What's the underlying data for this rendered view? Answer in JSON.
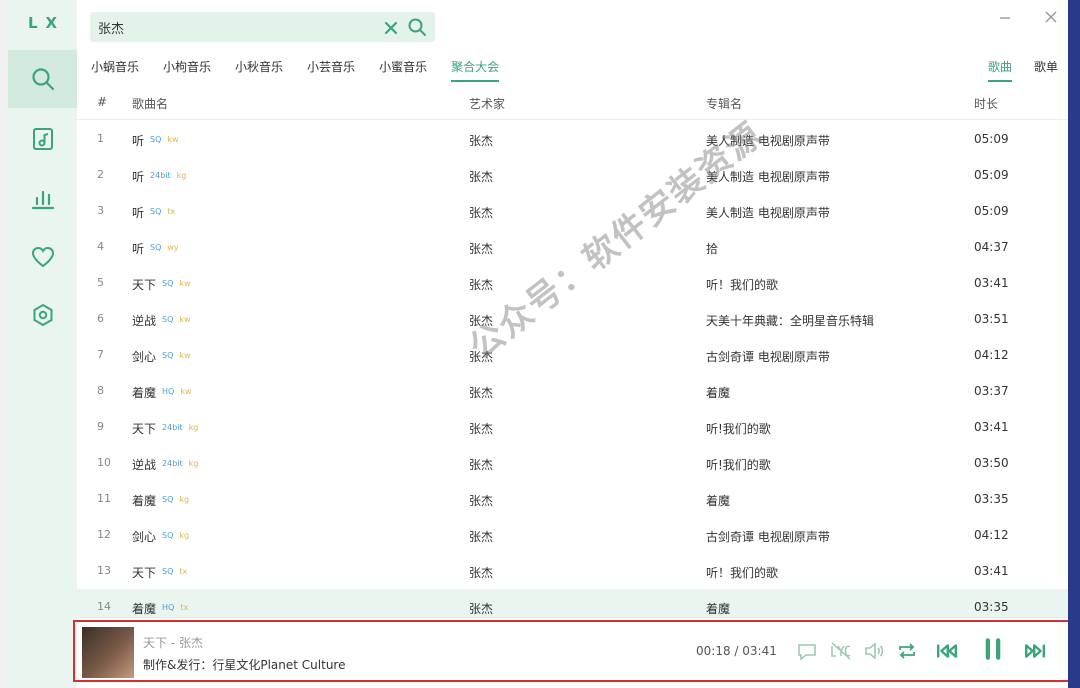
{
  "app": {
    "logo": "LX"
  },
  "search": {
    "value": "张杰"
  },
  "source_tabs": [
    "小蜗音乐",
    "小枸音乐",
    "小秋音乐",
    "小芸音乐",
    "小蜜音乐",
    "聚合大会"
  ],
  "type_tabs": [
    "歌曲",
    "歌单"
  ],
  "table": {
    "headers": [
      "#",
      "歌曲名",
      "艺术家",
      "专辑名",
      "时长"
    ],
    "rows": [
      {
        "num": "1",
        "name": "听",
        "quality": "SQ",
        "source": "kw",
        "artist": "张杰",
        "album": "美人制造 电视剧原声带",
        "duration": "05:09"
      },
      {
        "num": "2",
        "name": "听",
        "quality": "24bit",
        "source": "kg",
        "artist": "张杰",
        "album": "美人制造 电视剧原声带",
        "duration": "05:09"
      },
      {
        "num": "3",
        "name": "听",
        "quality": "SQ",
        "source": "tx",
        "artist": "张杰",
        "album": "美人制造 电视剧原声带",
        "duration": "05:09"
      },
      {
        "num": "4",
        "name": "听",
        "quality": "SQ",
        "source": "wy",
        "artist": "张杰",
        "album": "拾",
        "duration": "04:37"
      },
      {
        "num": "5",
        "name": "天下",
        "quality": "SQ",
        "source": "kw",
        "artist": "张杰",
        "album": "听！我们的歌",
        "duration": "03:41"
      },
      {
        "num": "6",
        "name": "逆战",
        "quality": "SQ",
        "source": "kw",
        "artist": "张杰",
        "album": "天美十年典藏：全明星音乐特辑",
        "duration": "03:51"
      },
      {
        "num": "7",
        "name": "剑心",
        "quality": "SQ",
        "source": "kw",
        "artist": "张杰",
        "album": "古剑奇谭 电视剧原声带",
        "duration": "04:12"
      },
      {
        "num": "8",
        "name": "着魔",
        "quality": "HQ",
        "source": "kw",
        "artist": "张杰",
        "album": "着魔",
        "duration": "03:37"
      },
      {
        "num": "9",
        "name": "天下",
        "quality": "24bit",
        "source": "kg",
        "artist": "张杰",
        "album": "听!我们的歌",
        "duration": "03:41"
      },
      {
        "num": "10",
        "name": "逆战",
        "quality": "24bit",
        "source": "kg",
        "artist": "张杰",
        "album": "听!我们的歌",
        "duration": "03:50"
      },
      {
        "num": "11",
        "name": "着魔",
        "quality": "SQ",
        "source": "kg",
        "artist": "张杰",
        "album": "着魔",
        "duration": "03:35"
      },
      {
        "num": "12",
        "name": "剑心",
        "quality": "SQ",
        "source": "kg",
        "artist": "张杰",
        "album": "古剑奇谭 电视剧原声带",
        "duration": "04:12"
      },
      {
        "num": "13",
        "name": "天下",
        "quality": "SQ",
        "source": "tx",
        "artist": "张杰",
        "album": "听！我们的歌",
        "duration": "03:41"
      },
      {
        "num": "14",
        "name": "着魔",
        "quality": "HQ",
        "source": "tx",
        "artist": "张杰",
        "album": "着魔",
        "duration": "03:35"
      }
    ]
  },
  "player": {
    "title": "天下 - 张杰",
    "subtitle": "制作&发行：行星文化Planet Culture",
    "time": "00:18 / 03:41"
  },
  "watermark": "公众号：软件安装资源",
  "colors": {
    "accent": "#3aa57a",
    "sidebar": "#eaf5ef",
    "highlight": "#d32f2f"
  },
  "icons": {
    "nav": [
      "search-icon",
      "music-list-icon",
      "chart-icon",
      "heart-icon",
      "settings-icon"
    ],
    "player": [
      "comment-icon",
      "lyric-icon",
      "volume-icon",
      "repeat-icon",
      "previous-icon",
      "pause-icon",
      "next-icon"
    ]
  }
}
